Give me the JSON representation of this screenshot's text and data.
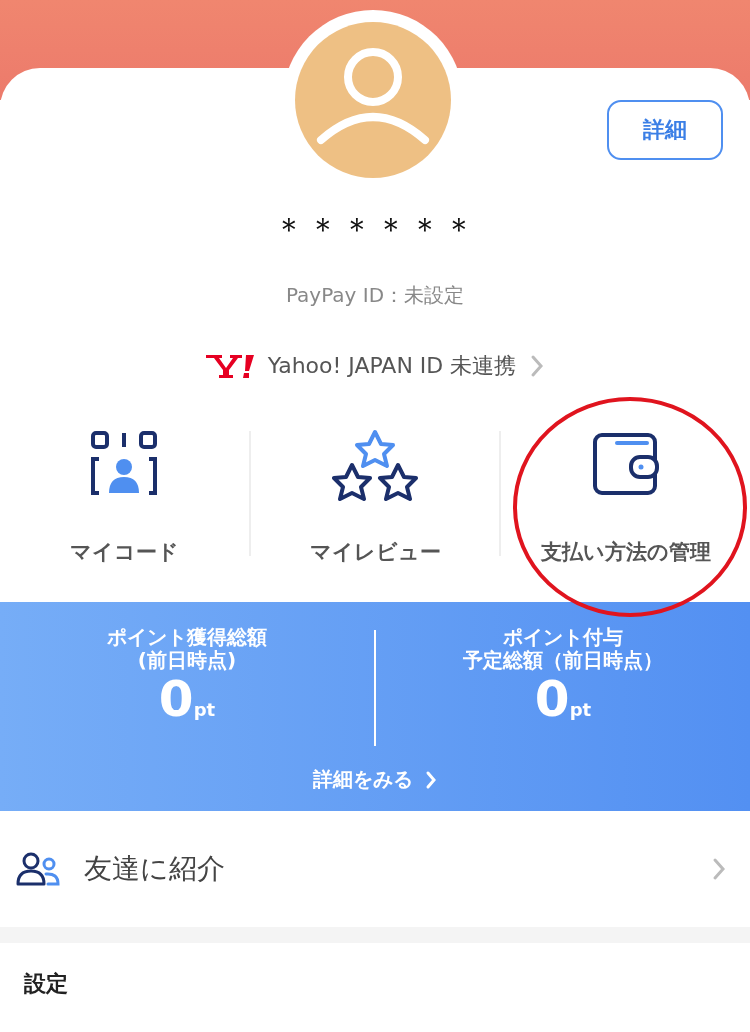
{
  "profile": {
    "name": "＊＊＊＊＊＊",
    "paypay_id": "PayPay ID：未設定",
    "details_button": "詳細"
  },
  "yahoo_link": {
    "label": "Yahoo! JAPAN ID 未連携"
  },
  "shortcuts": [
    {
      "kind": "code",
      "label": "マイコード",
      "highlighted": false
    },
    {
      "kind": "review",
      "label": "マイレビュー",
      "highlighted": false
    },
    {
      "kind": "wallet",
      "label": "支払い方法の管理",
      "highlighted": true
    }
  ],
  "points": {
    "items": [
      {
        "label_lines": [
          "ポイント獲得総額",
          "(前日時点)"
        ],
        "value": "0",
        "unit": "pt"
      },
      {
        "label_lines": [
          "ポイント付与",
          "予定総額（前日時点）"
        ],
        "value": "0",
        "unit": "pt"
      }
    ],
    "link": "詳細をみる"
  },
  "menu": [
    {
      "label": "友達に紹介"
    }
  ],
  "section_title": "設定"
}
